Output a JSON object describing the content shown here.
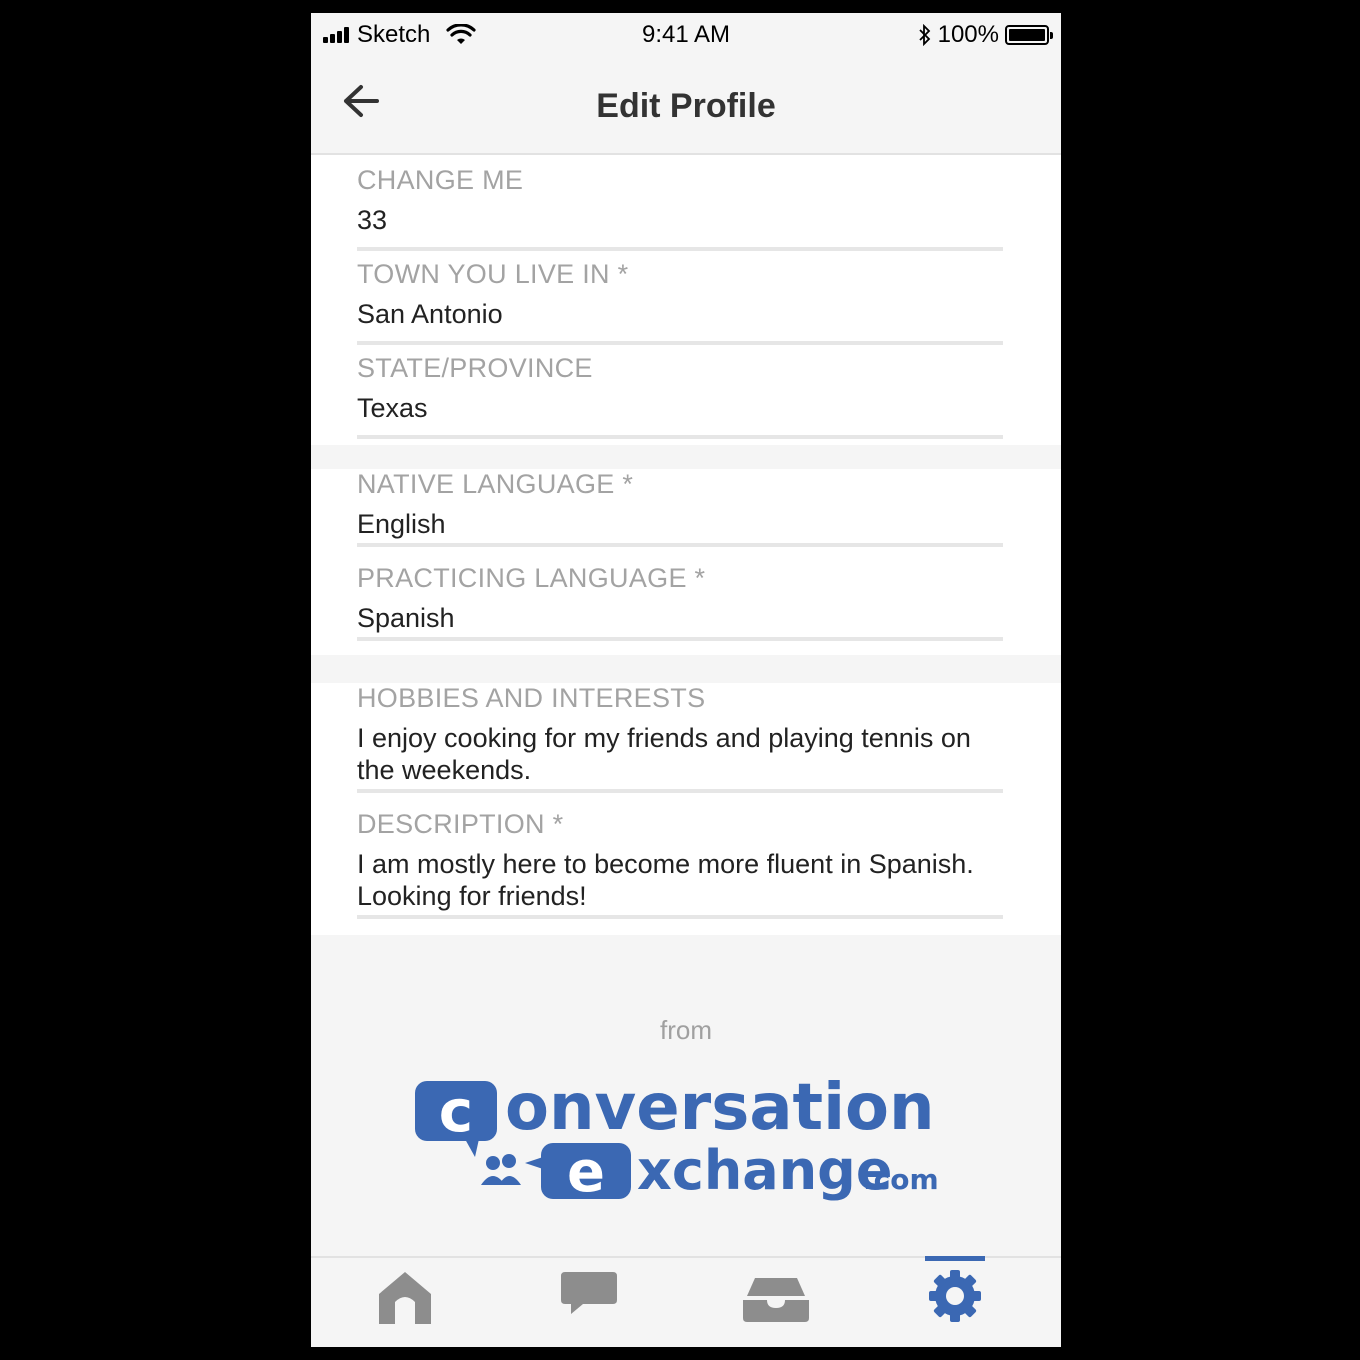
{
  "status_bar": {
    "carrier": "Sketch",
    "time": "9:41 AM",
    "battery": "100%"
  },
  "header": {
    "title": "Edit Profile",
    "back_icon": "arrow-left-icon"
  },
  "sections": [
    {
      "fields": [
        {
          "label": "CHANGE ME",
          "value": "33"
        },
        {
          "label": "TOWN YOU LIVE IN *",
          "value": "San Antonio"
        },
        {
          "label": "STATE/PROVINCE",
          "value": "Texas"
        }
      ]
    },
    {
      "fields": [
        {
          "label": "NATIVE LANGUAGE *",
          "value": "English"
        },
        {
          "label": "PRACTICING LANGUAGE *",
          "value": "Spanish"
        }
      ]
    },
    {
      "fields": [
        {
          "label": "HOBBIES AND INTERESTS",
          "value": "I enjoy cooking for my friends and playing tennis on the weekends."
        },
        {
          "label": "DESCRIPTION *",
          "value": "I am mostly here to become more fluent in Spanish. Looking for friends!"
        }
      ]
    }
  ],
  "footer": {
    "from": "from",
    "logo_line1": "conversation",
    "logo_line2": "exchange",
    "logo_suffix": ".com"
  },
  "tabbar": {
    "tabs": [
      {
        "icon": "home-icon"
      },
      {
        "icon": "chat-icon"
      },
      {
        "icon": "inbox-icon"
      },
      {
        "icon": "gear-icon",
        "active": true
      }
    ],
    "active_color": "#3b68b3",
    "inactive_color": "#8d8d8d"
  }
}
